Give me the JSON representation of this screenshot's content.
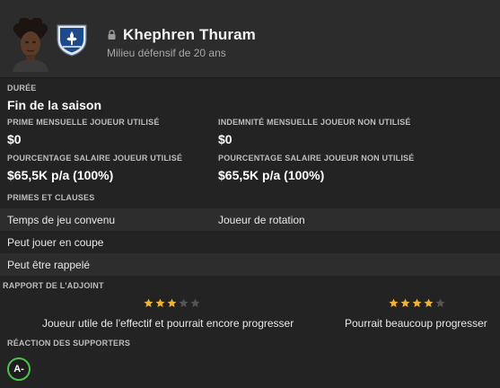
{
  "player": {
    "name": "Khephren Thuram",
    "description": "Milieu défensif de 20 ans"
  },
  "contract": {
    "duration_label": "Durée",
    "duration_value": "Fin de la saison",
    "bonus_used_label": "Prime mensuelle joueur utilisé",
    "bonus_used_value": "$0",
    "bonus_unused_label": "Indemnité mensuelle joueur non utilisé",
    "bonus_unused_value": "$0",
    "salary_used_label": "Pourcentage salaire joueur utilisé",
    "salary_used_value": "$65,5K p/a (100%)",
    "salary_unused_label": "Pourcentage salaire joueur non utilisé",
    "salary_unused_value": "$65,5K p/a (100%)"
  },
  "clauses": {
    "heading": "Primes et clauses",
    "rows": [
      {
        "left": "Temps de jeu convenu",
        "right": "Joueur de rotation"
      },
      {
        "left": "Peut jouer en coupe",
        "right": ""
      },
      {
        "left": "Peut être rappelé",
        "right": ""
      }
    ]
  },
  "report": {
    "heading": "Rapport de l'adjoint",
    "current": {
      "stars": 3,
      "max": 5,
      "text": "Joueur utile de l'effectif et pourrait encore progresser"
    },
    "potential": {
      "stars": 4,
      "max": 5,
      "text": "Pourrait beaucoup progresser"
    }
  },
  "supporters": {
    "heading": "Réaction des supporters",
    "grade": "A-"
  },
  "colors": {
    "star_filled": "#f2b233",
    "star_empty": "#555555",
    "grade_ring": "#4cc24c"
  }
}
